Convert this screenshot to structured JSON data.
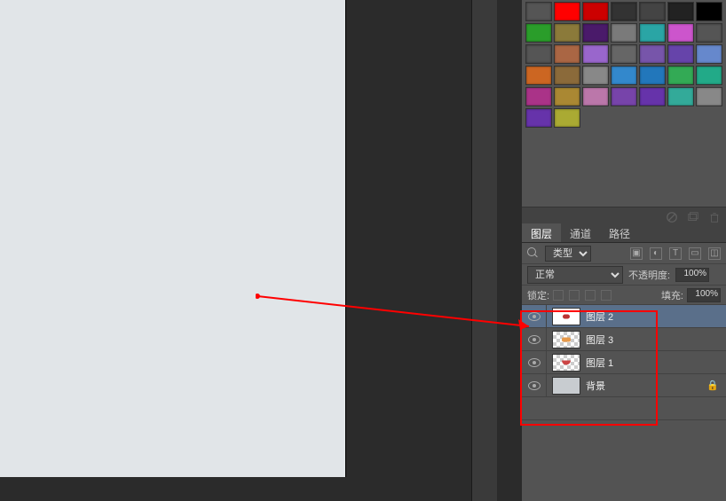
{
  "swatches": {
    "rows": [
      [
        "#555",
        "#ff0000",
        "#cc0000",
        "#333",
        "#444",
        "#222",
        "#000"
      ],
      [
        "#2a9d2a",
        "#8b7a3a",
        "#4a1a6a",
        "#7a7a7a",
        "#2aa5a5",
        "#cc55cc",
        "#555"
      ],
      [
        "#555",
        "#aa6644",
        "#9966cc",
        "#666",
        "#7755aa",
        "#6644aa",
        "#6688cc"
      ],
      [
        "#cc6622",
        "#8b6a3a",
        "#888",
        "#3388cc",
        "#2277bb",
        "#33aa55",
        "#22aa88"
      ],
      [
        "#aa3388",
        "#aa8833",
        "#bb77aa",
        "#7744aa",
        "#6633aa",
        "#33aa99",
        "#888"
      ]
    ],
    "last_row": [
      "#6633aa",
      "#aaaa33"
    ]
  },
  "tabs": {
    "layers": "图层",
    "channels": "通道",
    "paths": "路径"
  },
  "filter": {
    "kind_label": "类型"
  },
  "blend": {
    "mode": "正常",
    "opacity_label": "不透明度:",
    "opacity_value": "100%"
  },
  "lock": {
    "label": "锁定:",
    "fill_label": "填充:",
    "fill_value": "100%"
  },
  "layers": [
    {
      "name": "图层 2",
      "selected": true,
      "thumb": "white-dot-red",
      "checker": false
    },
    {
      "name": "图层 3",
      "selected": false,
      "thumb": "checker-orange",
      "checker": true
    },
    {
      "name": "图层 1",
      "selected": false,
      "thumb": "checker-mouth",
      "checker": true
    },
    {
      "name": "背景",
      "selected": false,
      "thumb": "solid-gray",
      "checker": false,
      "locked": true
    }
  ]
}
